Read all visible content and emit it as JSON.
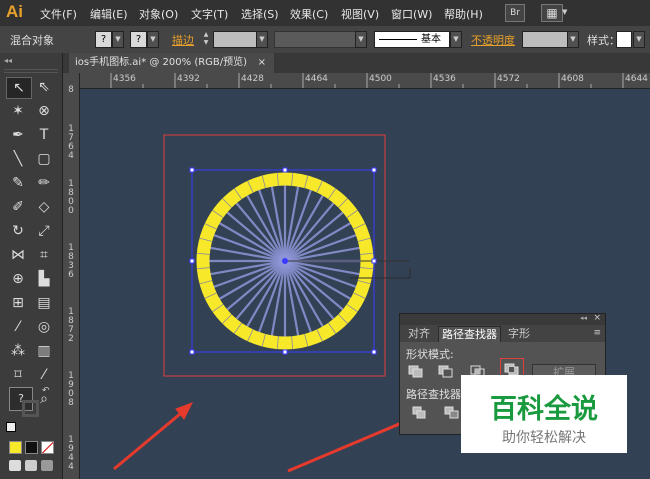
{
  "app_logo": "Ai",
  "menu": [
    "文件(F)",
    "编辑(E)",
    "对象(O)",
    "文字(T)",
    "选择(S)",
    "效果(C)",
    "视图(V)",
    "窗口(W)",
    "帮助(H)"
  ],
  "menubar_icons": {
    "bridge": "Br"
  },
  "control_bar": {
    "object_type": "混合对象",
    "stroke_label": "描边",
    "stroke_style": "基本",
    "opacity_label": "不透明度",
    "style_label": "样式"
  },
  "document_tab": {
    "title": "ios手机图标.ai* @ 200% (RGB/预览)",
    "close": "×"
  },
  "ruler": {
    "h_ticks": [
      "4356",
      "4392",
      "4428",
      "4464",
      "4500",
      "4536",
      "4572",
      "4608",
      "4644"
    ],
    "v_ticks": [
      "8",
      "1764",
      "1800",
      "1836",
      "1872",
      "1908",
      "1944"
    ]
  },
  "tools": {
    "type": "T",
    "fill_default": "?"
  },
  "pathfinder": {
    "tabs": [
      "对齐",
      "路径查找器",
      "字形"
    ],
    "shape_modes_label": "形状模式:",
    "expand_label": "扩展",
    "pathfinders_label": "路径查找器:"
  },
  "watermark": {
    "title": "百科全说",
    "subtitle": "助你轻松解决"
  },
  "colors": {
    "canvas": "#334155",
    "selection": "#3a3aff",
    "artboard_border": "#e0403c",
    "ring_fill": "#f7e92a",
    "arrow": "#e53a2c",
    "watermark_green": "#1a9a3e"
  }
}
